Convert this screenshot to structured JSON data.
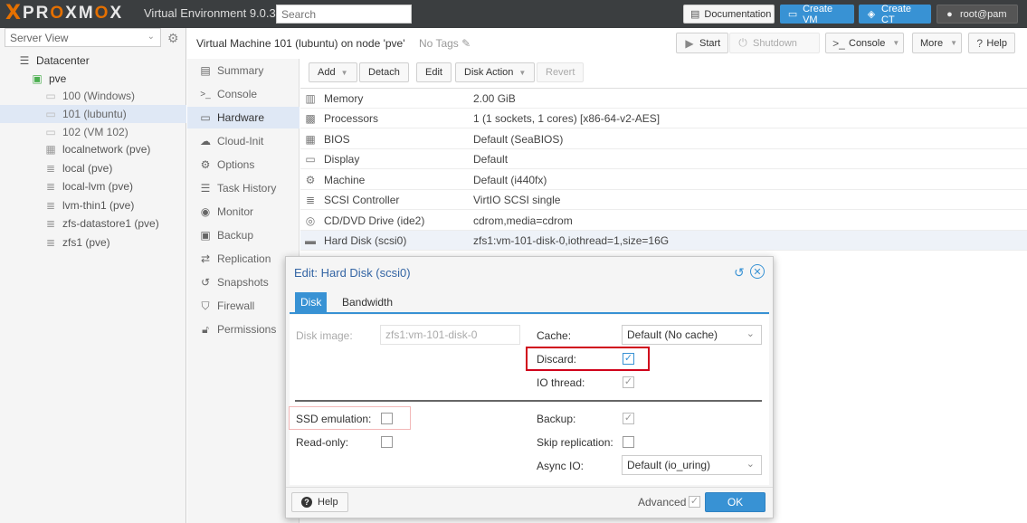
{
  "topbar": {
    "logo_x": "X",
    "logo_text_a": "PR",
    "logo_text_o1": "O",
    "logo_text_b": "XM",
    "logo_text_o2": "O",
    "logo_text_c": "X",
    "version": "Virtual Environment 9.0.3",
    "search_placeholder": "Search",
    "documentation": "Documentation",
    "create_vm": "Create VM",
    "create_ct": "Create CT",
    "user": "root@pam"
  },
  "sidebar": {
    "view": "Server View",
    "items": [
      {
        "label": "Datacenter",
        "icon": "server-icon"
      },
      {
        "label": "pve",
        "icon": "node-icon"
      },
      {
        "label": "100 (Windows)",
        "icon": "monitor-icon"
      },
      {
        "label": "101 (lubuntu)",
        "icon": "monitor-icon"
      },
      {
        "label": "102 (VM 102)",
        "icon": "monitor-icon"
      },
      {
        "label": "localnetwork (pve)",
        "icon": "grid-icon"
      },
      {
        "label": "local (pve)",
        "icon": "storage-icon"
      },
      {
        "label": "local-lvm (pve)",
        "icon": "storage-icon"
      },
      {
        "label": "lvm-thin1 (pve)",
        "icon": "storage-icon"
      },
      {
        "label": "zfs-datastore1 (pve)",
        "icon": "storage-icon"
      },
      {
        "label": "zfs1 (pve)",
        "icon": "storage-icon"
      }
    ]
  },
  "header": {
    "title": "Virtual Machine 101 (lubuntu) on node 'pve'",
    "no_tags": "No Tags",
    "start": "Start",
    "shutdown": "Shutdown",
    "console": "Console",
    "more": "More",
    "help": "Help"
  },
  "config_menu": [
    {
      "label": "Summary",
      "icon": "book-icon"
    },
    {
      "label": "Console",
      "icon": "terminal-icon"
    },
    {
      "label": "Hardware",
      "icon": "desktop-icon"
    },
    {
      "label": "Cloud-Init",
      "icon": "cloud-icon"
    },
    {
      "label": "Options",
      "icon": "gear-icon"
    },
    {
      "label": "Task History",
      "icon": "list-icon"
    },
    {
      "label": "Monitor",
      "icon": "eye-icon"
    },
    {
      "label": "Backup",
      "icon": "floppy-icon"
    },
    {
      "label": "Replication",
      "icon": "retweet-icon"
    },
    {
      "label": "Snapshots",
      "icon": "history-icon"
    },
    {
      "label": "Firewall",
      "icon": "shield-icon"
    },
    {
      "label": "Permissions",
      "icon": "unlock-icon"
    }
  ],
  "hardware_toolbar": {
    "add": "Add",
    "detach": "Detach",
    "edit": "Edit",
    "disk_action": "Disk Action",
    "revert": "Revert"
  },
  "hardware": [
    {
      "name": "Memory",
      "value": "2.00 GiB",
      "icon": "memory-icon"
    },
    {
      "name": "Processors",
      "value": "1 (1 sockets, 1 cores) [x86-64-v2-AES]",
      "icon": "cpu-icon"
    },
    {
      "name": "BIOS",
      "value": "Default (SeaBIOS)",
      "icon": "chip-icon"
    },
    {
      "name": "Display",
      "value": "Default",
      "icon": "desktop-icon"
    },
    {
      "name": "Machine",
      "value": "Default (i440fx)",
      "icon": "cogs-icon"
    },
    {
      "name": "SCSI Controller",
      "value": "VirtIO SCSI single",
      "icon": "database-icon"
    },
    {
      "name": "CD/DVD Drive (ide2)",
      "value": "cdrom,media=cdrom",
      "icon": "cdrom-icon"
    },
    {
      "name": "Hard Disk (scsi0)",
      "value": "zfs1:vm-101-disk-0,iothread=1,size=16G",
      "icon": "hdd-icon"
    }
  ],
  "dialog": {
    "title": "Edit: Hard Disk (scsi0)",
    "tabs": [
      "Disk",
      "Bandwidth"
    ],
    "disk_image_label": "Disk image:",
    "disk_image_value": "zfs1:vm-101-disk-0",
    "cache_label": "Cache:",
    "cache_value": "Default (No cache)",
    "discard_label": "Discard:",
    "discard_checked": true,
    "io_thread_label": "IO thread:",
    "io_thread_checked": true,
    "ssd_label": "SSD emulation:",
    "ssd_checked": false,
    "readonly_label": "Read-only:",
    "readonly_checked": false,
    "backup_label": "Backup:",
    "backup_checked": true,
    "skip_repl_label": "Skip replication:",
    "skip_repl_checked": false,
    "async_label": "Async IO:",
    "async_value": "Default (io_uring)",
    "help": "Help",
    "advanced": "Advanced",
    "advanced_checked": true,
    "ok": "OK"
  },
  "colors": {
    "accent": "#3892d4",
    "topbar": "#3b3e40",
    "brand": "#e57000",
    "highlight_red": "#d0021b",
    "highlight_pink": "#f2b8b8"
  }
}
